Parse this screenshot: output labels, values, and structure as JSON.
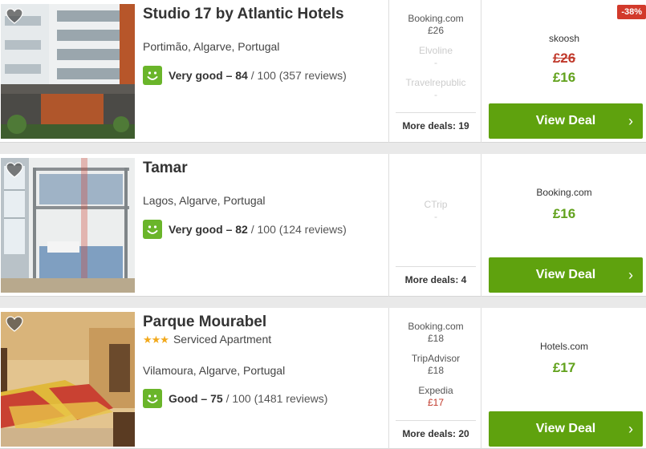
{
  "hotels": [
    {
      "name": "Studio 17 by Atlantic Hotels",
      "location": "Portimão, Algarve, Portugal",
      "rating_label": "Very good – 84",
      "rating_rest": " / 100 (357 reviews)",
      "deals": [
        {
          "site": "Booking.com",
          "price": "£26"
        },
        {
          "site": "Elvoline",
          "price": "-"
        },
        {
          "site": "Travelrepublic",
          "price": "-"
        }
      ],
      "more_deals": "More deals: 19",
      "best_site": "skoosh",
      "old_price": "£26",
      "price": "£16",
      "discount": "-38%",
      "button": "View Deal"
    },
    {
      "name": "Tamar",
      "location": "Lagos, Algarve, Portugal",
      "rating_label": "Very good – 82",
      "rating_rest": " / 100 (124 reviews)",
      "deals": [
        {
          "site": "CTrip",
          "price": "-"
        }
      ],
      "more_deals": "More deals: 4",
      "best_site": "Booking.com",
      "price": "£16",
      "button": "View Deal"
    },
    {
      "name": "Parque Mourabel",
      "stars": "★★★",
      "category": "Serviced Apartment",
      "location": "Vilamoura, Algarve, Portugal",
      "rating_label": "Good – 75",
      "rating_rest": " / 100 (1481 reviews)",
      "deals": [
        {
          "site": "Booking.com",
          "price": "£18"
        },
        {
          "site": "TripAdvisor",
          "price": "£18"
        },
        {
          "site": "Expedia",
          "price": "£17"
        }
      ],
      "more_deals": "More deals: 20",
      "best_site": "Hotels.com",
      "price": "£17",
      "button": "View Deal"
    }
  ],
  "icons": {
    "favorite": "heart-icon",
    "rating": "smiley-icon",
    "button": "chevron-right-icon"
  },
  "colors": {
    "rating_green": "#6ab52a",
    "price_green": "#62a21d",
    "button_green": "#5fa20e",
    "discount_red": "#d23a2b"
  }
}
